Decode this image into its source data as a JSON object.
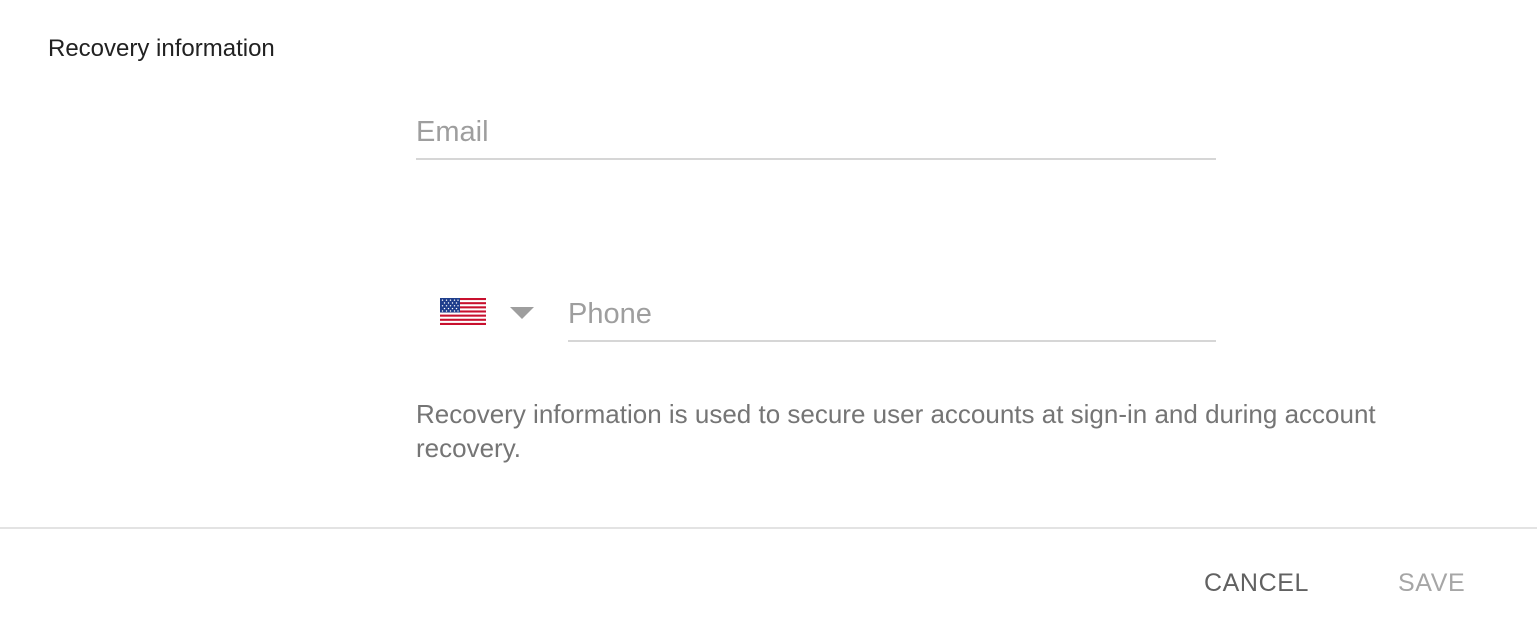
{
  "section": {
    "title": "Recovery information"
  },
  "email": {
    "placeholder": "Email",
    "value": ""
  },
  "phone": {
    "country_flag": "us-flag-icon",
    "country_code": "US",
    "placeholder": "Phone",
    "value": ""
  },
  "help_text": "Recovery information is used to secure user accounts at sign-in and during account recovery.",
  "actions": {
    "cancel_label": "CANCEL",
    "save_label": "SAVE",
    "save_enabled": false
  },
  "colors": {
    "title": "#212121",
    "placeholder": "#9e9e9e",
    "help_text": "#757575",
    "cancel": "#616161",
    "save_disabled": "#a6a6a6",
    "divider": "#e3e3e3"
  }
}
